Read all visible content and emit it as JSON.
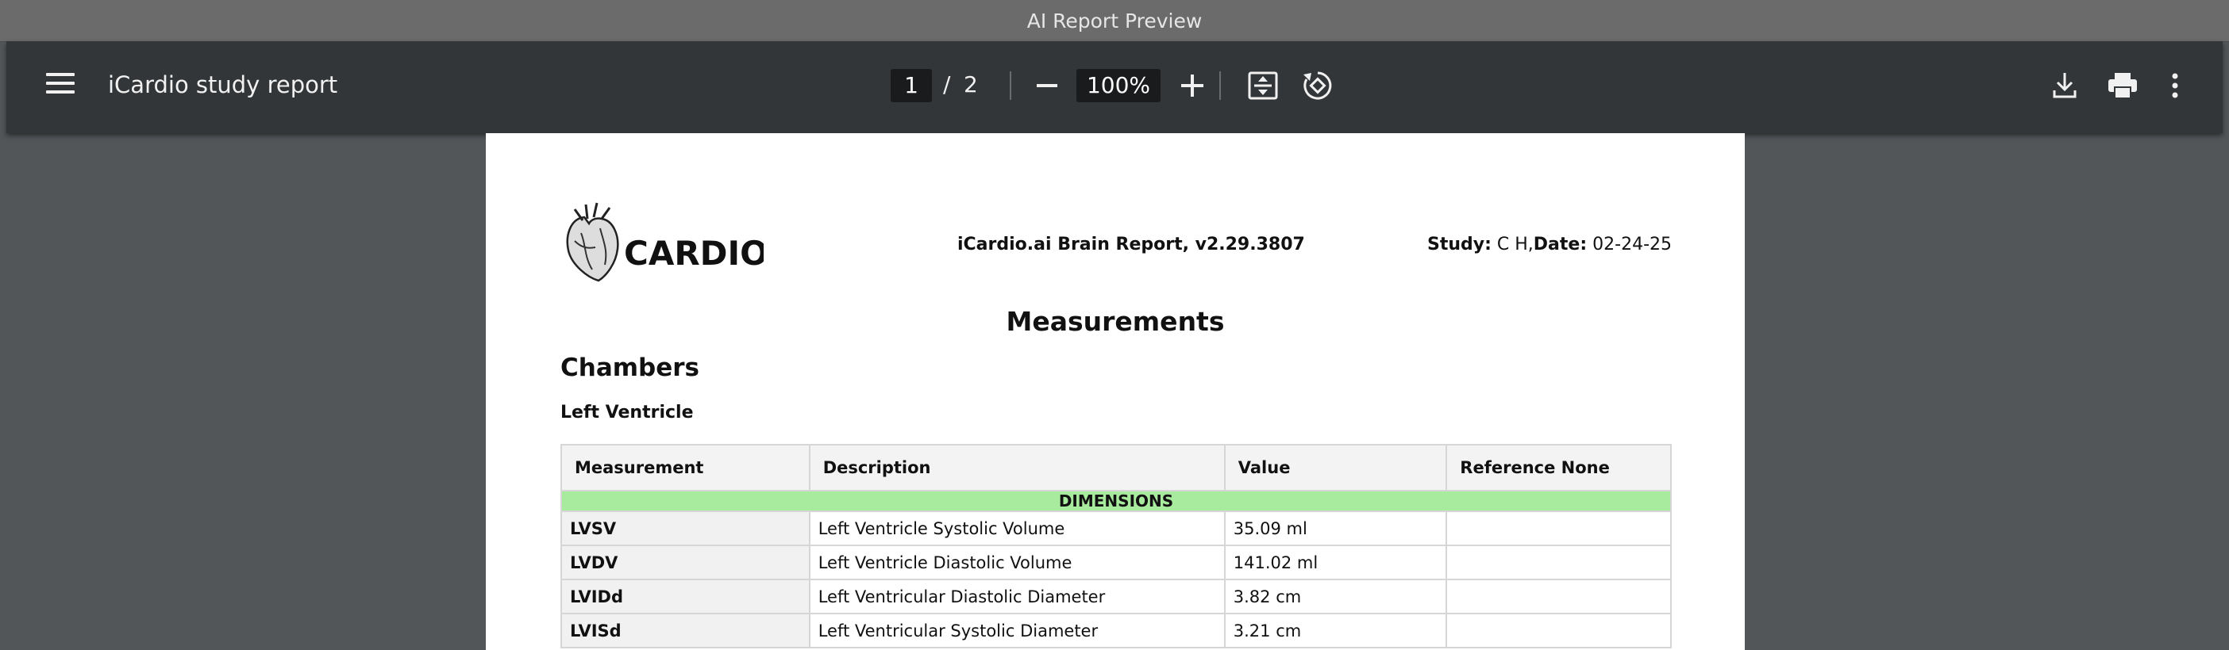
{
  "window": {
    "title": "AI Report Preview"
  },
  "toolbar": {
    "document_title": "iCardio study report",
    "current_page": "1",
    "page_separator": "/",
    "total_pages": "2",
    "zoom": "100%"
  },
  "report": {
    "logo_text": "CARDIO.ai",
    "title": "iCardio.ai Brain Report, v2.29.3807",
    "study_label": "Study:",
    "study_value": "C H,",
    "date_label": "Date:",
    "date_value": "02-24-25",
    "heading": "Measurements",
    "section": "Chambers",
    "subsection": "Left Ventricle",
    "table": {
      "headers": [
        "Measurement",
        "Description",
        "Value",
        "Reference None"
      ],
      "group": "DIMENSIONS",
      "rows": [
        [
          "LVSV",
          "Left Ventricle Systolic Volume",
          "35.09 ml",
          ""
        ],
        [
          "LVDV",
          "Left Ventricle Diastolic Volume",
          "141.02 ml",
          ""
        ],
        [
          "LVIDd",
          "Left Ventricular Diastolic Diameter",
          "3.82 cm",
          ""
        ],
        [
          "LVISd",
          "Left Ventricular Systolic Diameter",
          "3.21 cm",
          ""
        ]
      ]
    }
  }
}
